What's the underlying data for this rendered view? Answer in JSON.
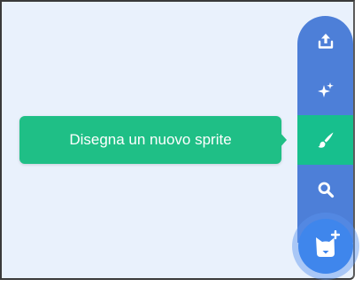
{
  "sprite_menu": {
    "tooltip_label": "Disegna un nuovo sprite",
    "items": [
      {
        "name": "upload-sprite",
        "icon": "upload-icon"
      },
      {
        "name": "surprise-sprite",
        "icon": "sparkles-icon"
      },
      {
        "name": "paint-sprite",
        "icon": "paintbrush-icon",
        "active": true
      },
      {
        "name": "choose-sprite",
        "icon": "search-icon"
      }
    ],
    "main_button_icon": "cat-plus-icon"
  },
  "colors": {
    "background": "#e9f1fc",
    "menu": "#4d7fd8",
    "active": "#17bf8d",
    "tooltip": "#1fbf86",
    "main_button": "#3f86ec"
  }
}
